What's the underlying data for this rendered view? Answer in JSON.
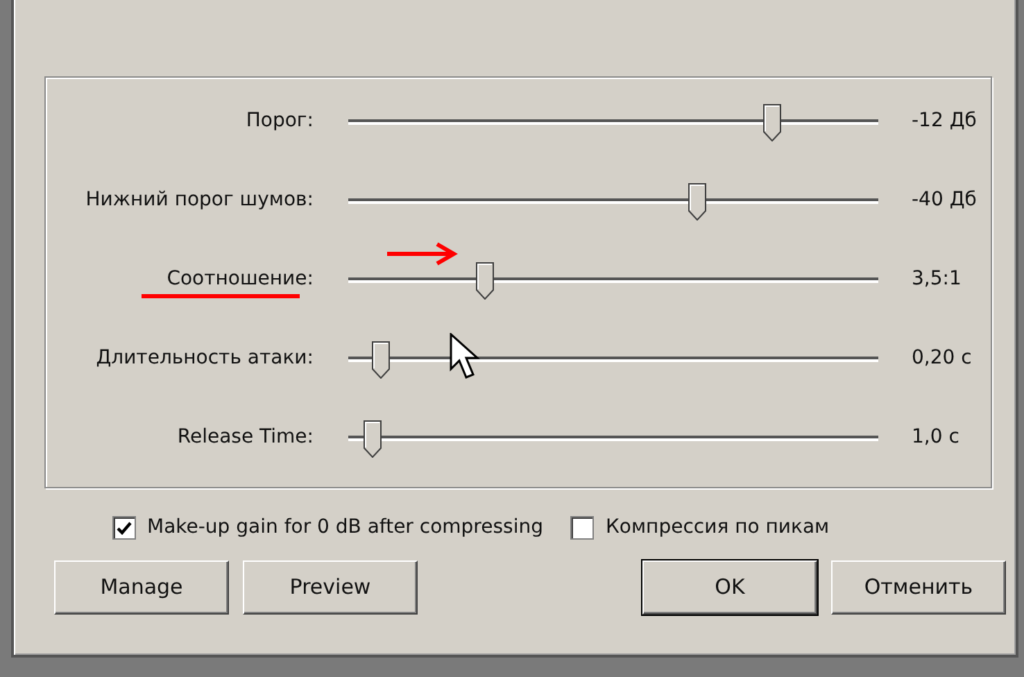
{
  "sliders": [
    {
      "label": "Порог:",
      "level": 0.81,
      "reading": "-12 Дб"
    },
    {
      "label": "Нижний порог шумов:",
      "level": 0.665,
      "reading": "-40 Дб"
    },
    {
      "label": "Соотношение:",
      "level": 0.25,
      "reading": "3,5:1"
    },
    {
      "label": "Длительность атаки:",
      "level": 0.045,
      "reading": "0,20 с"
    },
    {
      "label": "Release Time:",
      "level": 0.03,
      "reading": "1,0 с"
    }
  ],
  "options": [
    {
      "label": "Make-up gain for 0 dB after compressing",
      "checked": true
    },
    {
      "label": "Компрессия по пикам",
      "checked": false
    }
  ],
  "buttons": [
    {
      "label": "Manage",
      "default": false
    },
    {
      "label": "Preview",
      "default": false
    },
    {
      "label": "OK",
      "default": true
    },
    {
      "label": "Отменить",
      "default": false
    }
  ]
}
